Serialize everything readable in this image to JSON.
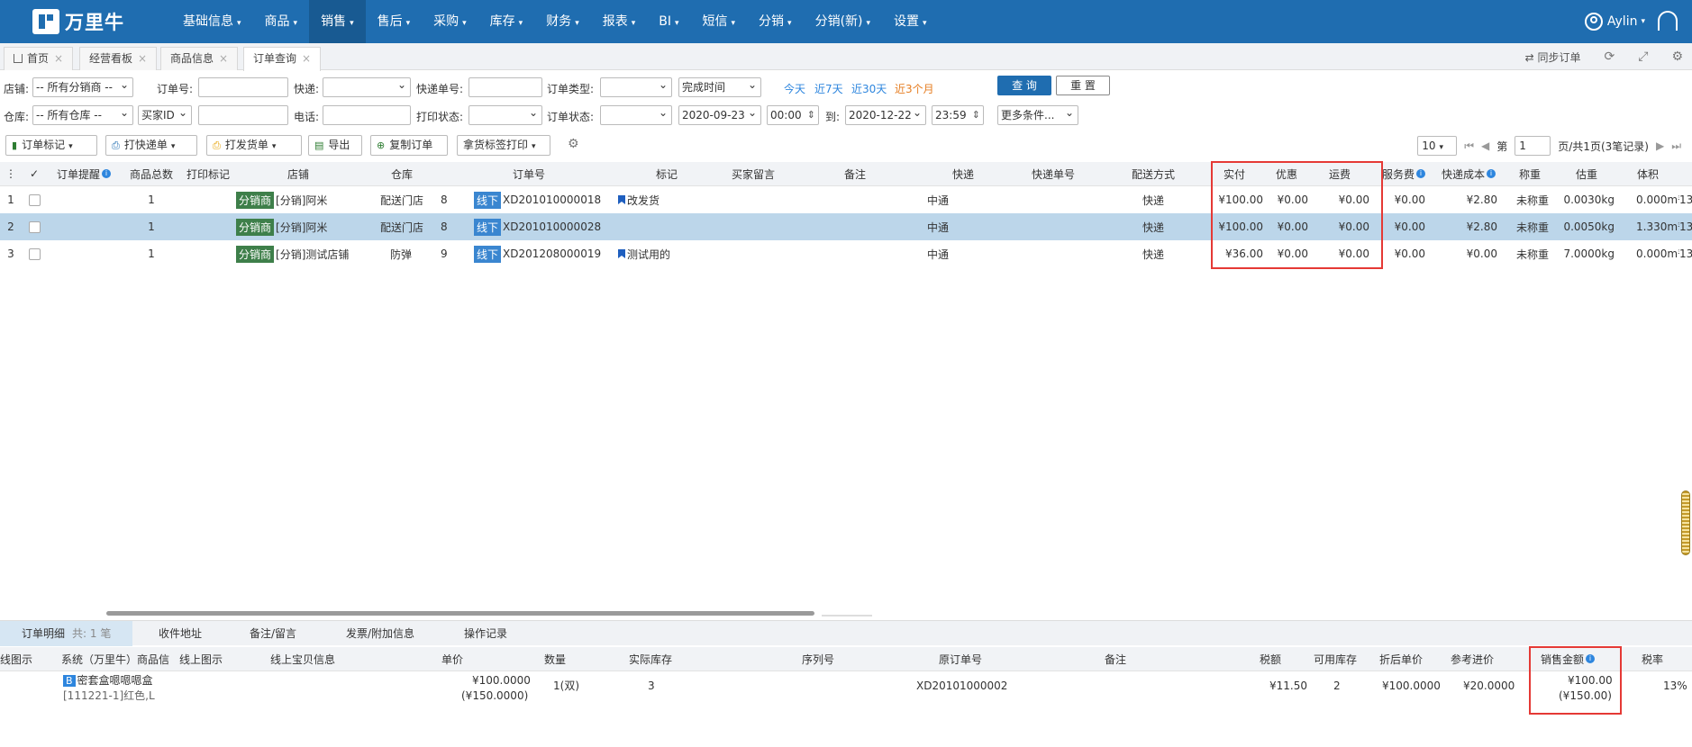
{
  "app": {
    "brand": "万里牛",
    "user": "Aylin"
  },
  "nav": [
    {
      "label": "基础信息"
    },
    {
      "label": "商品"
    },
    {
      "label": "销售"
    },
    {
      "label": "售后"
    },
    {
      "label": "采购"
    },
    {
      "label": "库存"
    },
    {
      "label": "财务"
    },
    {
      "label": "报表"
    },
    {
      "label": "BI"
    },
    {
      "label": "短信"
    },
    {
      "label": "分销"
    },
    {
      "label": "分销(新)"
    },
    {
      "label": "设置"
    }
  ],
  "tabs": [
    {
      "label": "首页"
    },
    {
      "label": "经营看板"
    },
    {
      "label": "商品信息"
    },
    {
      "label": "订单查询"
    }
  ],
  "tabbar": {
    "sync": "同步订单"
  },
  "filters": {
    "shop_label": "店铺:",
    "shop_value": "-- 所有分销商 --",
    "order_no_label": "订单号:",
    "express_label": "快递:",
    "express_no_label": "快递单号:",
    "order_type_label": "订单类型:",
    "time_type": "完成时间",
    "quick": [
      "今天",
      "近7天",
      "近30天",
      "近3个月"
    ],
    "warehouse_label": "仓库:",
    "warehouse_value": "-- 所有仓库 --",
    "buyer_id": "买家ID",
    "phone_label": "电话:",
    "print_status_label": "打印状态:",
    "order_status_label": "订单状态:",
    "date_from": "2020-09-23",
    "time_from": "00:00",
    "to_label": "到:",
    "date_to": "2020-12-22",
    "time_to": "23:59",
    "more": "更多条件...",
    "query": "查 询",
    "reset": "重 置"
  },
  "toolbar": {
    "mark": "订单标记",
    "print_express": "打快递单",
    "print_delivery": "打发货单",
    "export": "导出",
    "copy": "复制订单",
    "pick_print": "拿货标签打印"
  },
  "pager": {
    "page_size": "10",
    "page_label": "第",
    "page_no": "1",
    "summary": "页/共1页(3笔记录)"
  },
  "table": {
    "headers": [
      "订单提醒",
      "商品总数",
      "打印标记",
      "店铺",
      "仓库",
      "订单号",
      "标记",
      "买家留言",
      "备注",
      "快递",
      "快递单号",
      "配送方式",
      "实付",
      "优惠",
      "运费",
      "服务费",
      "快递成本",
      "称重",
      "估重",
      "体积"
    ],
    "rows": [
      {
        "idx": "1",
        "qty": "1",
        "shop_badge": "分销商",
        "shop": "[分销]阿米",
        "warehouse": "配送门店",
        "wh_no": "8",
        "order_badge": "线下",
        "order_no": "XD201010000018",
        "mark": "改发货",
        "express": "中通",
        "delivery": "快递",
        "paid": "¥100.00",
        "discount": "¥0.00",
        "freight": "¥0.00",
        "service": "¥0.00",
        "cost": "¥2.80",
        "weigh": "未称重",
        "est": "0.0030kg",
        "volume": "0.000m³",
        "extra": "13"
      },
      {
        "idx": "2",
        "qty": "1",
        "shop_badge": "分销商",
        "shop": "[分销]阿米",
        "warehouse": "配送门店",
        "wh_no": "8",
        "order_badge": "线下",
        "order_no": "XD201010000028",
        "mark": "",
        "express": "中通",
        "delivery": "快递",
        "paid": "¥100.00",
        "discount": "¥0.00",
        "freight": "¥0.00",
        "service": "¥0.00",
        "cost": "¥2.80",
        "weigh": "未称重",
        "est": "0.0050kg",
        "volume": "1.330m³",
        "extra": "13"
      },
      {
        "idx": "3",
        "qty": "1",
        "shop_badge": "分销商",
        "shop": "[分销]测试店铺",
        "warehouse": "防弹",
        "wh_no": "9",
        "order_badge": "线下",
        "order_no": "XD201208000019",
        "mark": "测试用的",
        "express": "中通",
        "delivery": "快递",
        "paid": "¥36.00",
        "discount": "¥0.00",
        "freight": "¥0.00",
        "service": "¥0.00",
        "cost": "¥0.00",
        "weigh": "未称重",
        "est": "7.0000kg",
        "volume": "0.000m³",
        "extra": "13"
      }
    ]
  },
  "detail": {
    "tabs": [
      "订单明细",
      "收件地址",
      "备注/留言",
      "发票/附加信息",
      "操作记录"
    ],
    "count": "共: 1 笔",
    "headers": [
      "线图示",
      "系统（万里牛）商品信",
      "线上图示",
      "线上宝贝信息",
      "单价",
      "数量",
      "实际库存",
      "序列号",
      "原订单号",
      "备注",
      "税额",
      "可用库存",
      "折后单价",
      "参考进价",
      "销售金额",
      "税率"
    ],
    "row": {
      "badge": "B",
      "goods_name": "密套盒嗯嗯嗯盒",
      "goods_spec": "[111221-1]红色,L",
      "price": "¥100.0000",
      "price_orig": "(¥150.0000)",
      "qty": "1(双)",
      "stock": "3",
      "orig_order": "XD20101000002",
      "tax": "¥11.50",
      "avail": "2",
      "disc_price": "¥100.0000",
      "ref_price": "¥20.0000",
      "sale_amount": "¥100.00",
      "sale_amount_orig": "(¥150.00)",
      "tax_rate": "13%"
    }
  }
}
